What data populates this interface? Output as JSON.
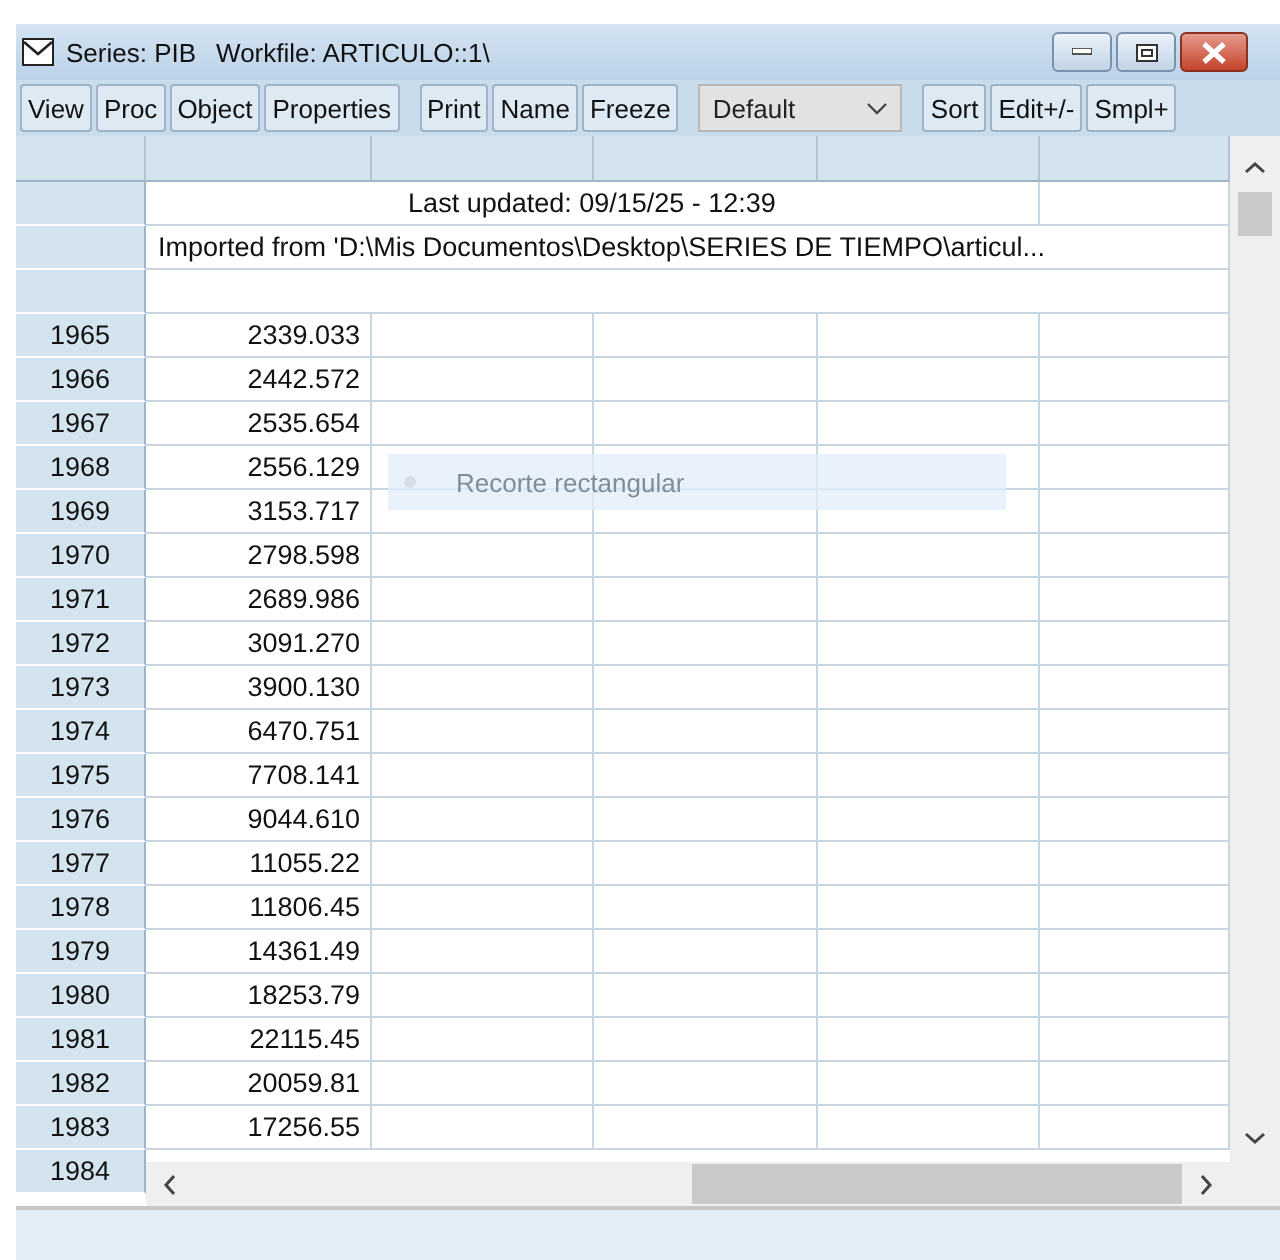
{
  "window": {
    "title_series": "Series: PIB",
    "title_workfile": "Workfile: ARTICULO::1\\"
  },
  "toolbar": {
    "groups": [
      [
        "View",
        "Proc",
        "Object",
        "Properties"
      ],
      [
        "Print",
        "Name",
        "Freeze"
      ]
    ],
    "dropdown": "Default",
    "trailing": [
      "Sort",
      "Edit+/-",
      "Smpl+"
    ]
  },
  "table": {
    "last_updated": "Last updated: 09/15/25 - 12:39",
    "source": "Imported from 'D:\\Mis Documentos\\Desktop\\SERIES DE TIEMPO\\articul...",
    "rows": [
      {
        "year": "1965",
        "value": "2339.033"
      },
      {
        "year": "1966",
        "value": "2442.572"
      },
      {
        "year": "1967",
        "value": "2535.654"
      },
      {
        "year": "1968",
        "value": "2556.129"
      },
      {
        "year": "1969",
        "value": "3153.717"
      },
      {
        "year": "1970",
        "value": "2798.598"
      },
      {
        "year": "1971",
        "value": "2689.986"
      },
      {
        "year": "1972",
        "value": "3091.270"
      },
      {
        "year": "1973",
        "value": "3900.130"
      },
      {
        "year": "1974",
        "value": "6470.751"
      },
      {
        "year": "1975",
        "value": "7708.141"
      },
      {
        "year": "1976",
        "value": "9044.610"
      },
      {
        "year": "1977",
        "value": "11055.22"
      },
      {
        "year": "1978",
        "value": "11806.45"
      },
      {
        "year": "1979",
        "value": "14361.49"
      },
      {
        "year": "1980",
        "value": "18253.79"
      },
      {
        "year": "1981",
        "value": "22115.45"
      },
      {
        "year": "1982",
        "value": "20059.81"
      },
      {
        "year": "1983",
        "value": "17256.55"
      },
      {
        "year": "1984"
      }
    ]
  },
  "overlay_hint": "Recorte rectangular"
}
